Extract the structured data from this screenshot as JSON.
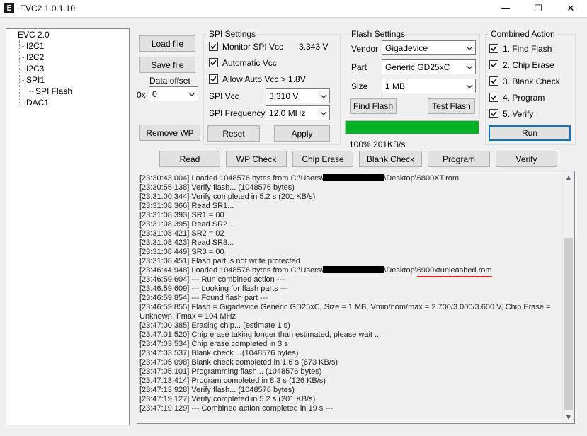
{
  "window": {
    "title": "EVC2 1.0.1.10",
    "icon_letter": "E",
    "controls": {
      "minimize": "—",
      "maximize": "☐",
      "close": "✕"
    }
  },
  "tree": {
    "root": "EVC 2.0",
    "items": [
      "I2C1",
      "I2C2",
      "I2C3",
      "SPI1",
      "SPI Flash",
      "DAC1"
    ]
  },
  "file_panel": {
    "load_label": "Load file",
    "save_label": "Save file",
    "offset_label": "Data offset",
    "offset_prefix": "0x",
    "offset_value": "0",
    "remove_wp_label": "Remove WP"
  },
  "spi": {
    "title": "SPI Settings",
    "monitor_label": "Monitor SPI Vcc",
    "monitor_value": "3.343 V",
    "auto_vcc_label": "Automatic Vcc",
    "allow_auto_label": "Allow Auto Vcc > 1.8V",
    "vcc_label": "SPI Vcc",
    "vcc_value": "3.310 V",
    "freq_label": "SPI Frequency",
    "freq_value": "12.0 MHz",
    "reset_label": "Reset",
    "apply_label": "Apply"
  },
  "flash": {
    "title": "Flash Settings",
    "vendor_label": "Vendor",
    "vendor_value": "Gigadevice",
    "part_label": "Part",
    "part_value": "Generic GD25xC",
    "size_label": "Size",
    "size_value": "1 MB",
    "find_label": "Find Flash",
    "test_label": "Test Flash",
    "progress_fraction": 1.0,
    "status_text": "100% 201KB/s"
  },
  "combined": {
    "title": "Combined Action",
    "items": [
      "1. Find Flash",
      "2. Chip Erase",
      "3. Blank Check",
      "4. Program",
      "5. Verify"
    ],
    "run_label": "Run"
  },
  "actions": [
    "Read",
    "WP Check",
    "Chip Erase",
    "Blank Check",
    "Program",
    "Verify"
  ],
  "log": {
    "lines": [
      {
        "pre": "[23:30:43.004] Loaded 1048576 bytes from C:\\Users\\",
        "redacted": true,
        "post": "\\Desktop\\6800XT.rom"
      },
      {
        "pre": "[23:30:55.138] Verify flash... (1048576 bytes)"
      },
      {
        "pre": "[23:31:00.344] Verify completed in 5.2 s (201 KB/s)"
      },
      {
        "pre": "[23:31:08.366] Read SR1..."
      },
      {
        "pre": "[23:31:08.393] SR1 = 00"
      },
      {
        "pre": "[23:31:08.395] Read SR2..."
      },
      {
        "pre": "[23:31:08.421] SR2 = 02"
      },
      {
        "pre": "[23:31:08.423] Read SR3..."
      },
      {
        "pre": "[23:31:08.449] SR3 = 00"
      },
      {
        "pre": "[23:31:08.451] Flash part is not write protected"
      },
      {
        "pre": "[23:46:44.948] Loaded 1048576 bytes from C:\\Users\\",
        "redacted": true,
        "post": "\\Desktop\\",
        "underlined": "6900xtunleashed.rom"
      },
      {
        "pre": "[23:46:59.604] --- Run combined action ---"
      },
      {
        "pre": "[23:46:59.609] --- Looking for flash parts ---"
      },
      {
        "pre": "[23:46:59.854] --- Found flash part ---"
      },
      {
        "pre": "[23:46:59.855] Flash = Gigadevice Generic GD25xC, Size = 1 MB, Vmin/nom/max = 2.700/3.000/3.600 V, Chip Erase = Unknown, Fmax = 104 MHz"
      },
      {
        "pre": "[23:47:00.385] Erasing chip... (estimate 1 s)"
      },
      {
        "pre": "[23:47:01.520] Chip erase taking longer than estimated, please wait ..."
      },
      {
        "pre": "[23:47:03.534] Chip erase completed in 3 s"
      },
      {
        "pre": "[23:47:03.537] Blank check... (1048576 bytes)"
      },
      {
        "pre": "[23:47:05.098] Blank check completed in 1.6 s (673 KB/s)"
      },
      {
        "pre": "[23:47:05.101] Programming flash... (1048576 bytes)"
      },
      {
        "pre": "[23:47:13.414] Program completed in 8.3 s (126 KB/s)"
      },
      {
        "pre": "[23:47:13.928] Verify flash... (1048576 bytes)"
      },
      {
        "pre": "[23:47:19.127] Verify completed in 5.2 s (201 KB/s)"
      },
      {
        "pre": "[23:47:19.129] --- Combined action completed in 19 s ---"
      }
    ],
    "scroll": {
      "up": "▲",
      "down": "▼"
    }
  }
}
